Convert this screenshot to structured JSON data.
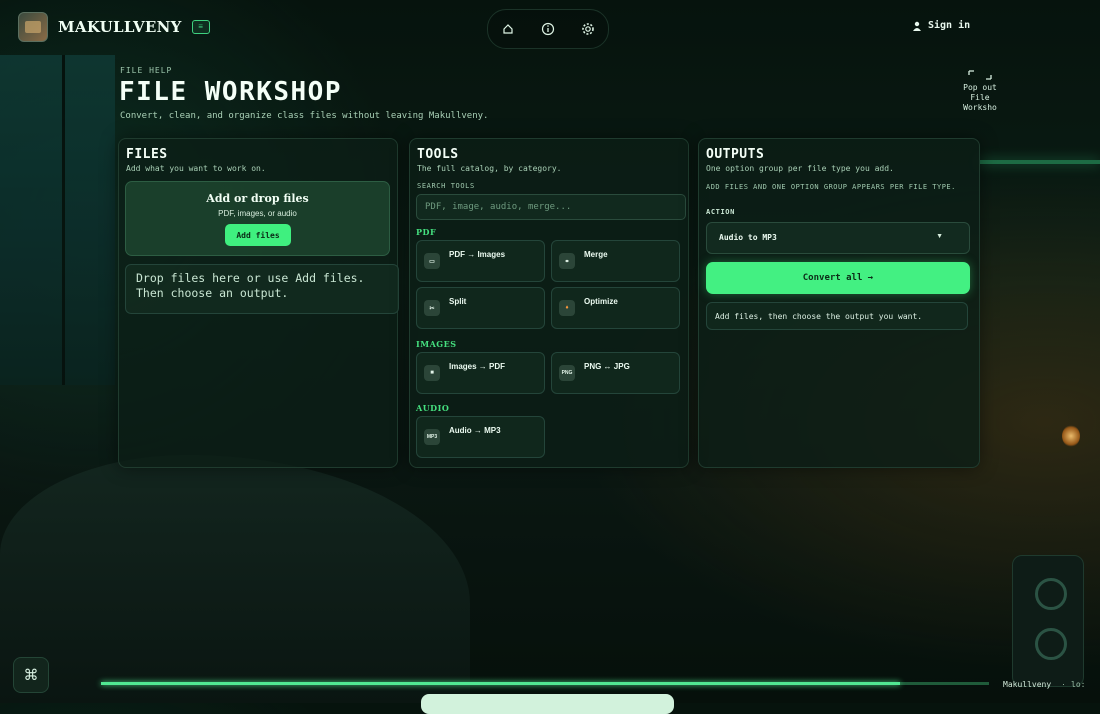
{
  "app": {
    "name": "MAKULLVENY"
  },
  "header": {
    "nav": [
      {
        "icon": "home-icon"
      },
      {
        "icon": "info-icon"
      },
      {
        "icon": "gear-icon"
      }
    ],
    "signin_label": "Sign in"
  },
  "hero": {
    "eyebrow": "FILE HELP",
    "title": "FILE WORKSHOP",
    "subtitle": "Convert, clean, and organize class files without leaving Makullveny.",
    "popout_label": "Pop out File Worksho"
  },
  "files": {
    "title": "FILES",
    "subtitle": "Add what you want to work on.",
    "drop_title": "Add or drop files",
    "drop_sub": "PDF, images, or audio",
    "add_button": "Add files",
    "hint": "Drop files here or use Add files.\nThen choose an output."
  },
  "tools": {
    "title": "TOOLS",
    "subtitle": "The full catalog, by category.",
    "search_label": "SEARCH TOOLS",
    "search_placeholder": "PDF, image, audio, merge...",
    "categories": [
      {
        "name": "PDF",
        "items": [
          {
            "label": "PDF → Images",
            "icon": "image-icon",
            "glyph": "▭"
          },
          {
            "label": "Merge",
            "icon": "link-icon",
            "glyph": "⚭"
          },
          {
            "label": "Split",
            "icon": "scissors-icon",
            "glyph": "✂"
          },
          {
            "label": "Optimize",
            "icon": "flame-icon",
            "glyph": "♦"
          }
        ]
      },
      {
        "name": "IMAGES",
        "items": [
          {
            "label": "Images → PDF",
            "icon": "file-icon",
            "glyph": "■"
          },
          {
            "label": "PNG ↔ JPG",
            "icon": "png-icon",
            "glyph": "PNG"
          }
        ]
      },
      {
        "name": "AUDIO",
        "items": [
          {
            "label": "Audio → MP3",
            "icon": "mp3-icon",
            "glyph": "MP3"
          }
        ]
      }
    ]
  },
  "outputs": {
    "title": "OUTPUTS",
    "subtitle": "One option group per file type you add.",
    "note": "ADD FILES AND ONE OPTION GROUP APPEARS PER FILE TYPE.",
    "action_label": "ACTION",
    "action_value": "Audio to MP3",
    "convert_button": "Convert all →",
    "message": "Add files, then choose the output you want."
  },
  "footer": {
    "brand": "Makullveny",
    "separator": "·",
    "extra": "lo:",
    "progress": 0.9,
    "command_icon": "command-icon"
  },
  "colors": {
    "accent": "#43f082",
    "panel": "#0c1e16",
    "background": "#06130d"
  }
}
